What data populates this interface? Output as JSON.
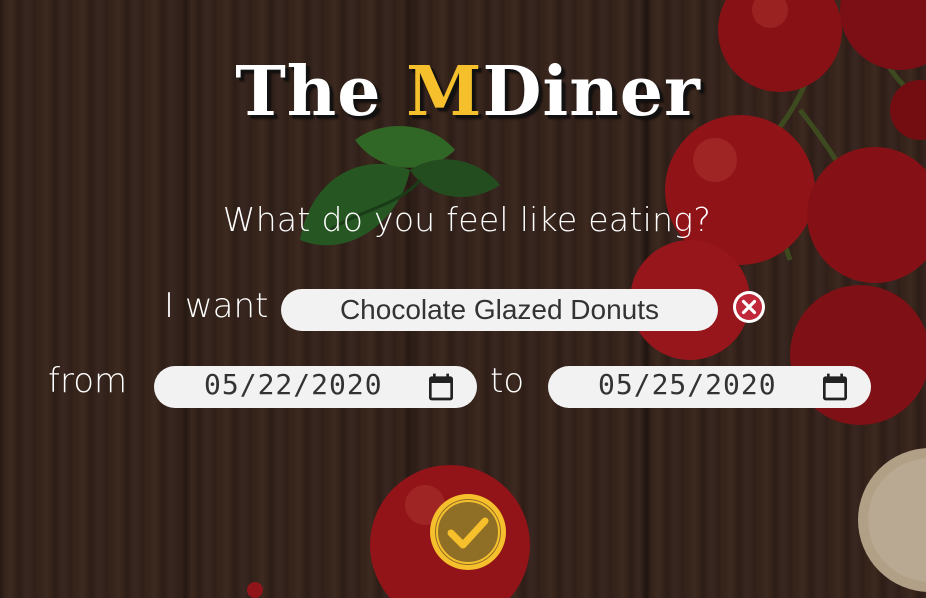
{
  "title": {
    "prefix": "The ",
    "highlight": "M",
    "suffix": "Diner"
  },
  "question": "What do you feel like eating?",
  "search": {
    "label": "I want",
    "value": "Chocolate Glazed Donuts",
    "clear_icon": "close-circle-icon"
  },
  "dates": {
    "from_label": "from",
    "from_value": "05/22/2020",
    "to_label": "to",
    "to_value": "05/25/2020",
    "calendar_icon": "calendar-icon"
  },
  "submit": {
    "icon": "checkmark-circle-icon"
  },
  "colors": {
    "accent": "#f6c02c",
    "text": "#ffffff",
    "field_bg": "#f2f2f2",
    "clear_icon": "#c0283a"
  }
}
